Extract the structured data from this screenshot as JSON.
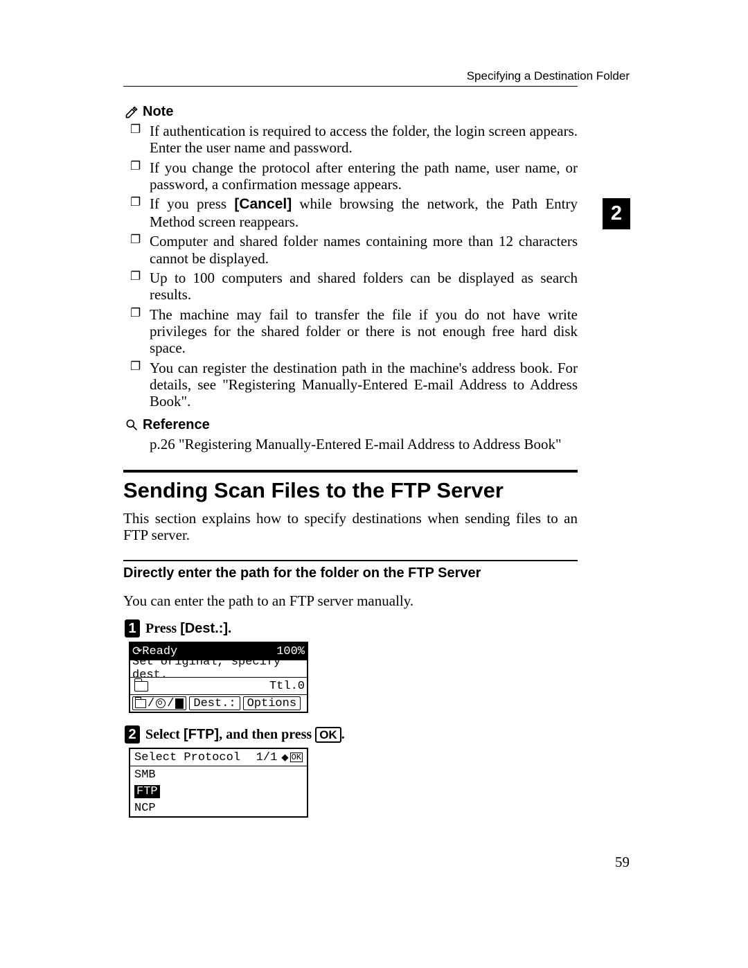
{
  "running_head": "Specifying a Destination Folder",
  "chapter_number": "2",
  "page_number": "59",
  "note": {
    "label": "Note",
    "items": [
      {
        "pre": "If authentication is required to access the folder, the login screen appears. Enter the user name and password."
      },
      {
        "pre": "If you change the protocol after entering the path name, user name, or password, a confirmation message appears."
      },
      {
        "pre": "If you press ",
        "bold": "[Cancel]",
        "post": " while browsing the network, the Path Entry Method screen reappears."
      },
      {
        "pre": "Computer and shared folder names containing more than 12 characters cannot be displayed."
      },
      {
        "pre": "Up to 100 computers and shared folders can be displayed as search results."
      },
      {
        "pre": "The machine may fail to transfer the file if you do not have write privileges for the shared folder or there is not enough free hard disk space."
      },
      {
        "pre": "You can register the destination path in the machine's address book. For details, see \"Registering Manually-Entered E-mail Address to Address Book\"."
      }
    ]
  },
  "reference": {
    "label": "Reference",
    "text": "p.26 \"Registering Manually-Entered E-mail Address to Address Book\""
  },
  "section": {
    "title": "Sending Scan Files to the FTP Server",
    "intro": "This section explains how to specify destinations when sending files to an FTP server."
  },
  "subsection": {
    "title": "Directly enter the path for the folder on the FTP Server",
    "intro": "You can enter the path to an FTP server manually."
  },
  "step1": {
    "num": "1",
    "pre": "Press ",
    "bold": "[Dest.:]",
    "post": "."
  },
  "step2": {
    "num": "2",
    "pre": "Select ",
    "bold1": "[FTP]",
    "mid": ", and then press ",
    "ok": "OK",
    "post": "."
  },
  "lcd1": {
    "status": "Ready",
    "percent": "100%",
    "line2": "Set original, specify dest.",
    "ttl": "Ttl.0",
    "soft_dest": "Dest.:",
    "soft_options": "Options"
  },
  "lcd2": {
    "title": "Select Protocol",
    "page": "1/1",
    "ok": "OK",
    "opts": [
      "SMB",
      "FTP",
      "NCP"
    ],
    "selected_index": 1
  }
}
